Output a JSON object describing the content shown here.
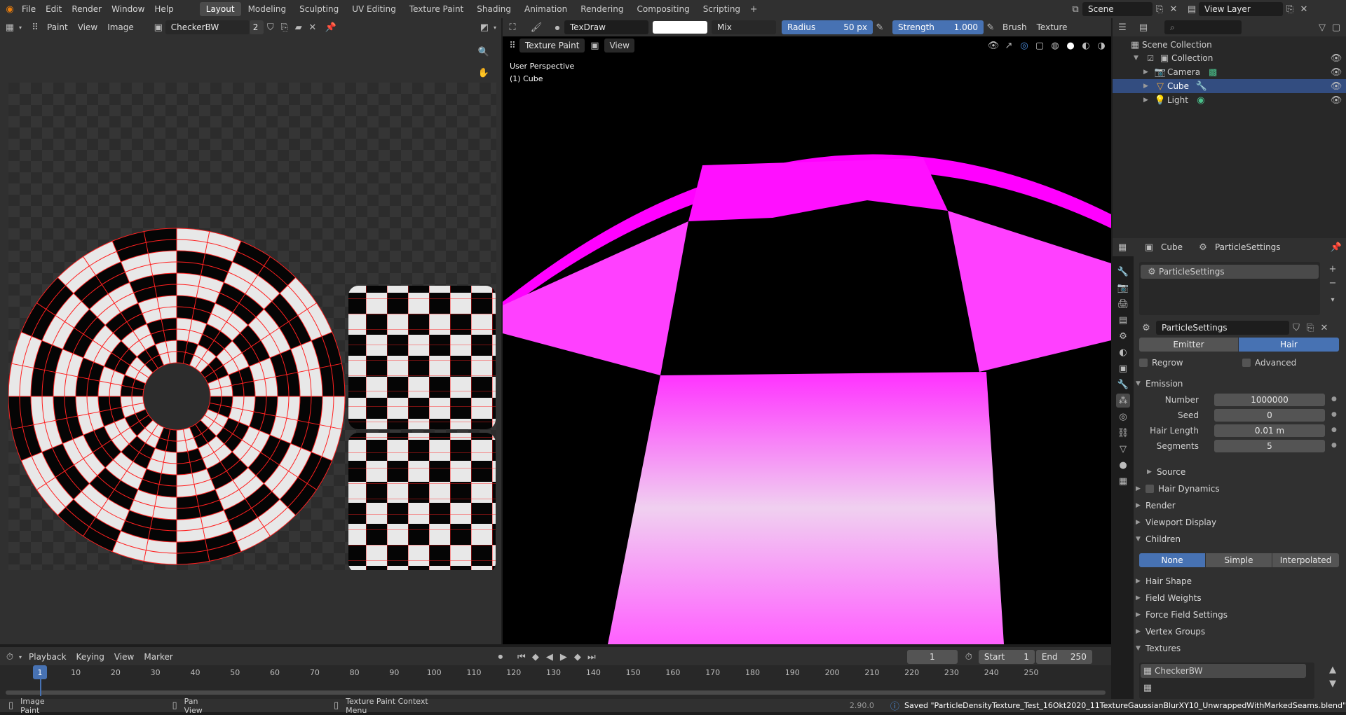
{
  "menu": [
    "File",
    "Edit",
    "Render",
    "Window",
    "Help"
  ],
  "workspaces": [
    "Layout",
    "Modeling",
    "Sculpting",
    "UV Editing",
    "Texture Paint",
    "Shading",
    "Animation",
    "Rendering",
    "Compositing",
    "Scripting"
  ],
  "active_workspace": "Layout",
  "scene": "Scene",
  "view_layer": "View Layer",
  "image_editor": {
    "mode": "Paint",
    "menus": [
      "View",
      "Image"
    ],
    "image_name": "CheckerBW",
    "users": "2"
  },
  "tool_header": {
    "brush_name": "TexDraw",
    "blend": "Mix",
    "radius_label": "Radius",
    "radius_value": "50 px",
    "strength_label": "Strength",
    "strength_value": "1.000",
    "strength_fraction": 1.0,
    "brush_menu": "Brush",
    "texture_menu": "Texture"
  },
  "viewport": {
    "mode": "Texture Paint",
    "view_menu": "View",
    "perspective": "User Perspective",
    "object": "(1) Cube"
  },
  "outliner": {
    "root": "Scene Collection",
    "collection": "Collection",
    "items": [
      "Camera",
      "Cube",
      "Light"
    ],
    "selected": "Cube"
  },
  "properties": {
    "object": "Cube",
    "particle_settings_crumb": "ParticleSettings",
    "slot": "ParticleSettings",
    "datablock": "ParticleSettings",
    "type_tabs": [
      "Emitter",
      "Hair"
    ],
    "active_type": "Hair",
    "regrow": "Regrow",
    "advanced": "Advanced",
    "emission": "Emission",
    "fields": [
      {
        "label": "Number",
        "value": "1000000"
      },
      {
        "label": "Seed",
        "value": "0"
      },
      {
        "label": "Hair Length",
        "value": "0.01 m"
      },
      {
        "label": "Segments",
        "value": "5"
      }
    ],
    "source": "Source",
    "hair_dynamics": "Hair Dynamics",
    "render": "Render",
    "viewport_display": "Viewport Display",
    "children": "Children",
    "children_tabs": [
      "None",
      "Simple",
      "Interpolated"
    ],
    "active_child": "None",
    "closed_sections": [
      "Hair Shape",
      "Field Weights",
      "Force Field Settings",
      "Vertex Groups"
    ],
    "textures": "Textures",
    "texture_item": "CheckerBW"
  },
  "timeline": {
    "menus": [
      "Playback",
      "Keying",
      "View",
      "Marker"
    ],
    "current_frame": "1",
    "start_label": "Start",
    "start": "1",
    "end_label": "End",
    "end": "250",
    "ticks": [
      "1",
      "10",
      "20",
      "30",
      "40",
      "50",
      "60",
      "70",
      "80",
      "90",
      "100",
      "110",
      "120",
      "130",
      "140",
      "150",
      "160",
      "170",
      "180",
      "190",
      "200",
      "210",
      "220",
      "230",
      "240",
      "250"
    ]
  },
  "status": {
    "left": "Image Paint",
    "middle": "Pan View",
    "context": "Texture Paint Context Menu",
    "version": "2.90.0",
    "message": "Saved \"ParticleDensityTexture_Test_16Okt2020_11TextureGaussianBlurXY10_UnwrappedWithMarkedSeams.blend\""
  },
  "colors": {
    "accent": "#4772b3",
    "magenta": "#ff00ff",
    "uv_wire": "#ff2020"
  }
}
